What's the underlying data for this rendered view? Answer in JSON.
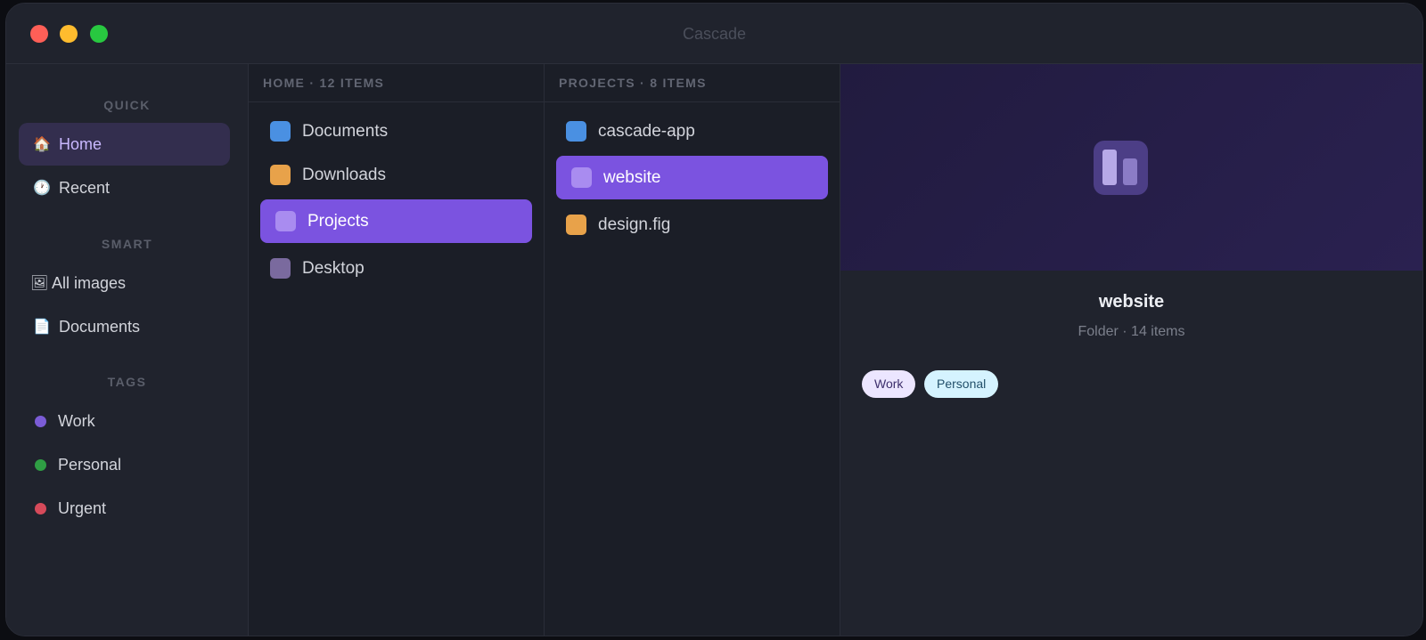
{
  "window": {
    "title": "Cascade"
  },
  "sidebar": {
    "sections": [
      {
        "label": "QUICK"
      },
      {
        "label": "SMART"
      },
      {
        "label": "TAGS"
      }
    ],
    "quick": [
      {
        "icon": "🏠",
        "label": "Home",
        "active": true
      },
      {
        "icon": "🕐",
        "label": "Recent"
      }
    ],
    "smart": [
      {
        "icon": "🖼",
        "label": "All images"
      },
      {
        "icon": "📄",
        "label": "Documents"
      }
    ],
    "tags": [
      {
        "label": "Work",
        "color": "#7b5cd6"
      },
      {
        "label": "Personal",
        "color": "#2f9e44"
      },
      {
        "label": "Urgent",
        "color": "#d64a5a"
      }
    ]
  },
  "columns": [
    {
      "header": "HOME · 12 ITEMS",
      "items": [
        {
          "label": "Documents",
          "color": "#4a90e2"
        },
        {
          "label": "Downloads",
          "color": "#e8a24a"
        },
        {
          "label": "Projects",
          "color": "#a98cf0",
          "selected": true
        },
        {
          "label": "Desktop",
          "color": "#7a6a9e"
        }
      ]
    },
    {
      "header": "PROJECTS · 8 ITEMS",
      "items": [
        {
          "label": "cascade-app",
          "color": "#4a90e2"
        },
        {
          "label": "website",
          "color": "#a98cf0",
          "selected": true
        },
        {
          "label": "design.fig",
          "color": "#e8a24a"
        }
      ]
    }
  ],
  "detail": {
    "name": "website",
    "meta": "Folder · 14 items",
    "icon": "folder-preview-icon",
    "tags": [
      {
        "label": "Work"
      },
      {
        "label": "Personal"
      }
    ]
  }
}
